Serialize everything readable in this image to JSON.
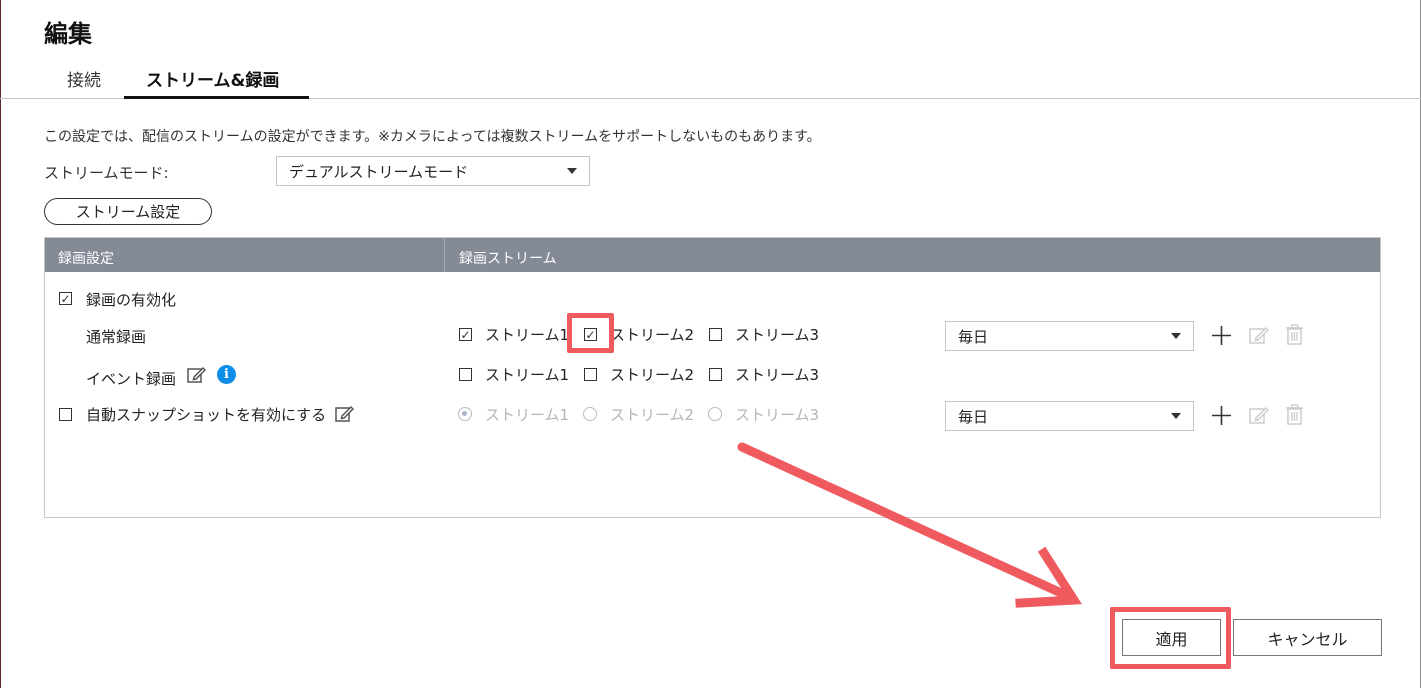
{
  "dialog": {
    "title": "編集",
    "tabs": [
      {
        "label": "接続",
        "active": false
      },
      {
        "label": "ストリーム&録画",
        "active": true
      }
    ]
  },
  "description": "この設定では、配信のストリームの設定ができます。※カメラによっては複数ストリームをサポートしないものもあります。",
  "stream_mode": {
    "label": "ストリームモード:",
    "value": "デュアルストリームモード"
  },
  "stream_settings_button": "ストリーム設定",
  "table": {
    "headers": [
      "録画設定",
      "録画ストリーム"
    ],
    "enable_recording": {
      "label": "録画の有効化",
      "checked": true
    },
    "normal_recording": {
      "label": "通常録画",
      "streams": [
        {
          "label": "ストリーム1",
          "checked": true
        },
        {
          "label": "ストリーム2",
          "checked": true
        },
        {
          "label": "ストリーム3",
          "checked": false
        }
      ],
      "schedule": "毎日"
    },
    "event_recording": {
      "label": "イベント録画",
      "streams": [
        {
          "label": "ストリーム1",
          "checked": false
        },
        {
          "label": "ストリーム2",
          "checked": false
        },
        {
          "label": "ストリーム3",
          "checked": false
        }
      ]
    },
    "auto_snapshot": {
      "label": "自動スナップショットを有効にする",
      "checked": false,
      "streams": [
        {
          "label": "ストリーム1",
          "selected": true
        },
        {
          "label": "ストリーム2",
          "selected": false
        },
        {
          "label": "ストリーム3",
          "selected": false
        }
      ],
      "schedule": "毎日"
    }
  },
  "footer": {
    "apply": "適用",
    "cancel": "キャンセル"
  },
  "colors": {
    "header_bg": "#848b97",
    "highlight": "#ef5a5f",
    "info": "#0e8ee9"
  },
  "icons": [
    "edit-icon",
    "info-icon",
    "plus-icon",
    "trash-icon",
    "dropdown-caret-icon",
    "arrow-annotation"
  ]
}
